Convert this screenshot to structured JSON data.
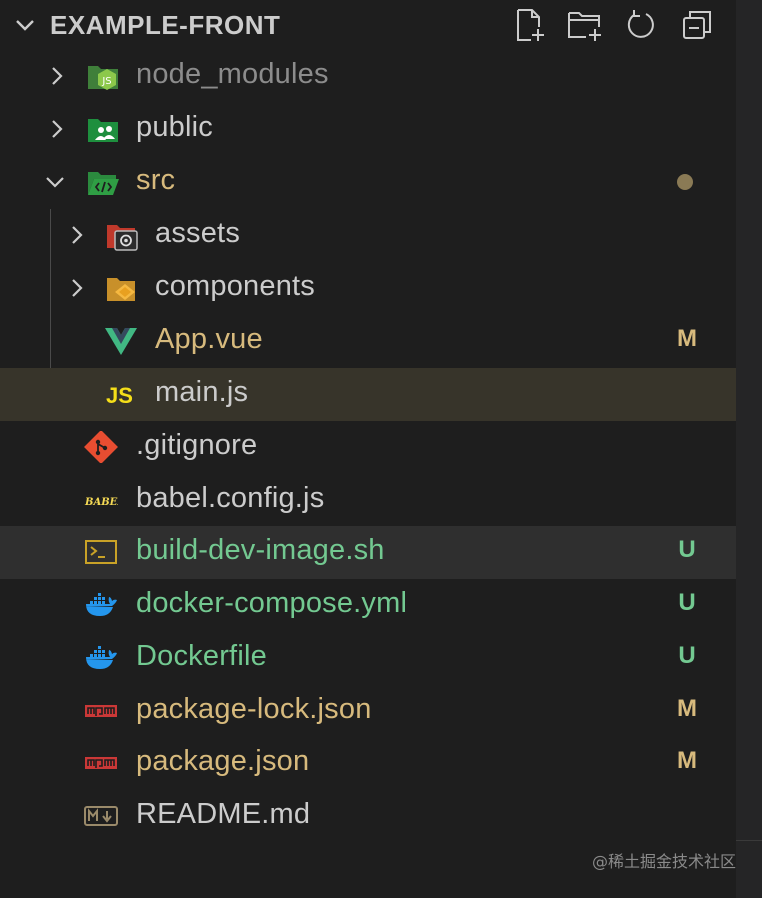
{
  "explorer": {
    "title": "EXAMPLE-FRONT",
    "actions": [
      "new-file",
      "new-folder",
      "refresh",
      "collapse-all"
    ]
  },
  "tree": [
    {
      "label": "node_modules",
      "kind": "folder",
      "expanded": false,
      "color": "#8c8c8c",
      "badge": ""
    },
    {
      "label": "public",
      "kind": "folder",
      "expanded": false,
      "color": "#cccccc",
      "badge": ""
    },
    {
      "label": "src",
      "kind": "folder",
      "expanded": true,
      "color": "#d7ba7d",
      "badge": "•"
    },
    {
      "label": "assets",
      "kind": "folder",
      "expanded": false,
      "color": "#cccccc",
      "badge": ""
    },
    {
      "label": "components",
      "kind": "folder",
      "expanded": false,
      "color": "#cccccc",
      "badge": ""
    },
    {
      "label": "App.vue",
      "kind": "file",
      "color": "#d7ba7d",
      "badge": "M"
    },
    {
      "label": "main.js",
      "kind": "file",
      "color": "#cccccc",
      "badge": ""
    },
    {
      "label": ".gitignore",
      "kind": "file",
      "color": "#cccccc",
      "badge": ""
    },
    {
      "label": "babel.config.js",
      "kind": "file",
      "color": "#cccccc",
      "badge": ""
    },
    {
      "label": "build-dev-image.sh",
      "kind": "file",
      "color": "#73c991",
      "badge": "U"
    },
    {
      "label": "docker-compose.yml",
      "kind": "file",
      "color": "#73c991",
      "badge": "U"
    },
    {
      "label": "Dockerfile",
      "kind": "file",
      "color": "#73c991",
      "badge": "U"
    },
    {
      "label": "package-lock.json",
      "kind": "file",
      "color": "#d7ba7d",
      "badge": "M"
    },
    {
      "label": "package.json",
      "kind": "file",
      "color": "#d7ba7d",
      "badge": "M"
    },
    {
      "label": "README.md",
      "kind": "file",
      "color": "#cccccc",
      "badge": ""
    }
  ],
  "colors": {
    "modified": "#d7ba7d",
    "untracked": "#73c991",
    "default": "#cccccc",
    "ignored": "#8c8c8c"
  },
  "watermark": "@稀土掘金技术社区"
}
